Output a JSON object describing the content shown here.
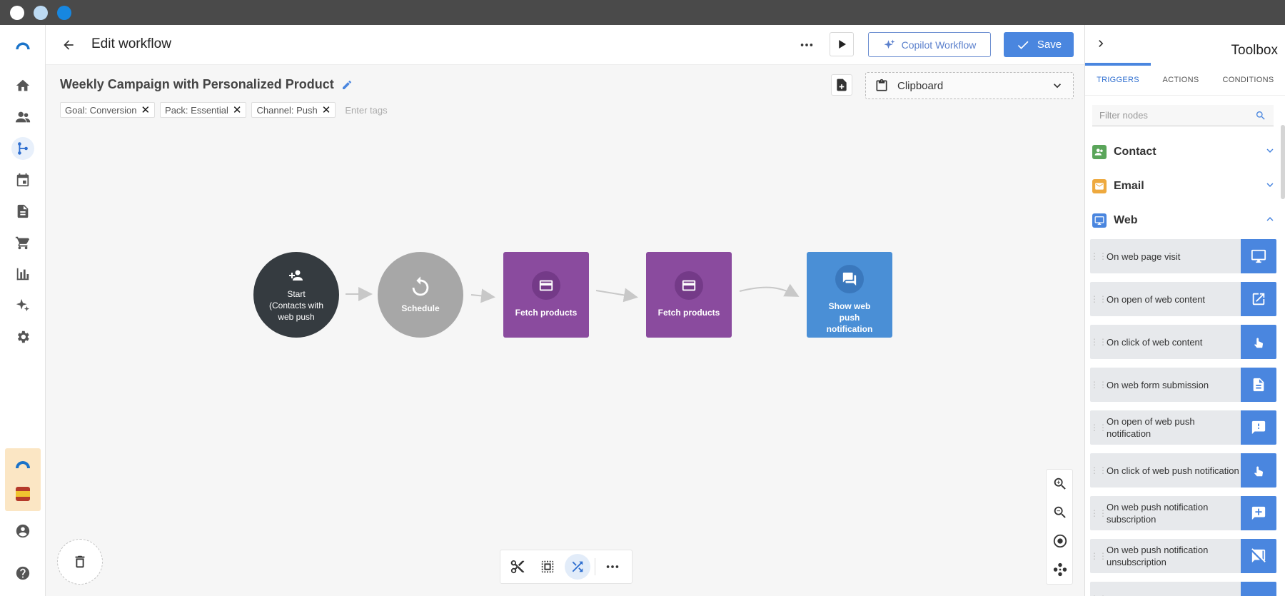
{
  "header": {
    "title": "Edit workflow",
    "copilot_label": "Copilot Workflow",
    "save_label": "Save"
  },
  "workflow": {
    "name": "Weekly Campaign with Personalized Product",
    "tags": [
      "Goal: Conversion",
      "Pack: Essential",
      "Channel: Push"
    ],
    "tags_placeholder": "Enter tags",
    "clipboard_label": "Clipboard"
  },
  "nodes": [
    {
      "label": "Start (Contacts with web push",
      "type": "start",
      "color": "#353b40"
    },
    {
      "label": "Schedule",
      "type": "schedule",
      "color": "#a7a7a7"
    },
    {
      "label": "Fetch products",
      "type": "action",
      "color": "#8a4b9e"
    },
    {
      "label": "Fetch products",
      "type": "action",
      "color": "#8a4b9e"
    },
    {
      "label": "Show web push notification",
      "type": "action",
      "color": "#4a8fd6"
    }
  ],
  "toolbox": {
    "title": "Toolbox",
    "tabs": [
      "TRIGGERS",
      "ACTIONS",
      "CONDITIONS"
    ],
    "active_tab": "TRIGGERS",
    "filter_placeholder": "Filter nodes",
    "categories": [
      {
        "label": "Contact",
        "color": "#5aa55a",
        "expanded": false
      },
      {
        "label": "Email",
        "color": "#eea93e",
        "expanded": false
      },
      {
        "label": "Web",
        "color": "#4a86df",
        "expanded": true
      }
    ],
    "items": [
      {
        "label": "On web page visit",
        "icon": "monitor-icon"
      },
      {
        "label": "On open of web content",
        "icon": "open-external-icon"
      },
      {
        "label": "On click of web content",
        "icon": "pointer-click-icon"
      },
      {
        "label": "On web form submission",
        "icon": "document-icon"
      },
      {
        "label": "On open of web push notification",
        "icon": "alert-message-icon"
      },
      {
        "label": "On click of web push notification",
        "icon": "pointer-click-icon"
      },
      {
        "label": "On web push notification subscription",
        "icon": "add-message-icon"
      },
      {
        "label": "On web push notification unsubscription",
        "icon": "disabled-message-icon"
      }
    ]
  },
  "colors": {
    "accent": "#4a86df",
    "titlebar": "#4a4a4a"
  }
}
